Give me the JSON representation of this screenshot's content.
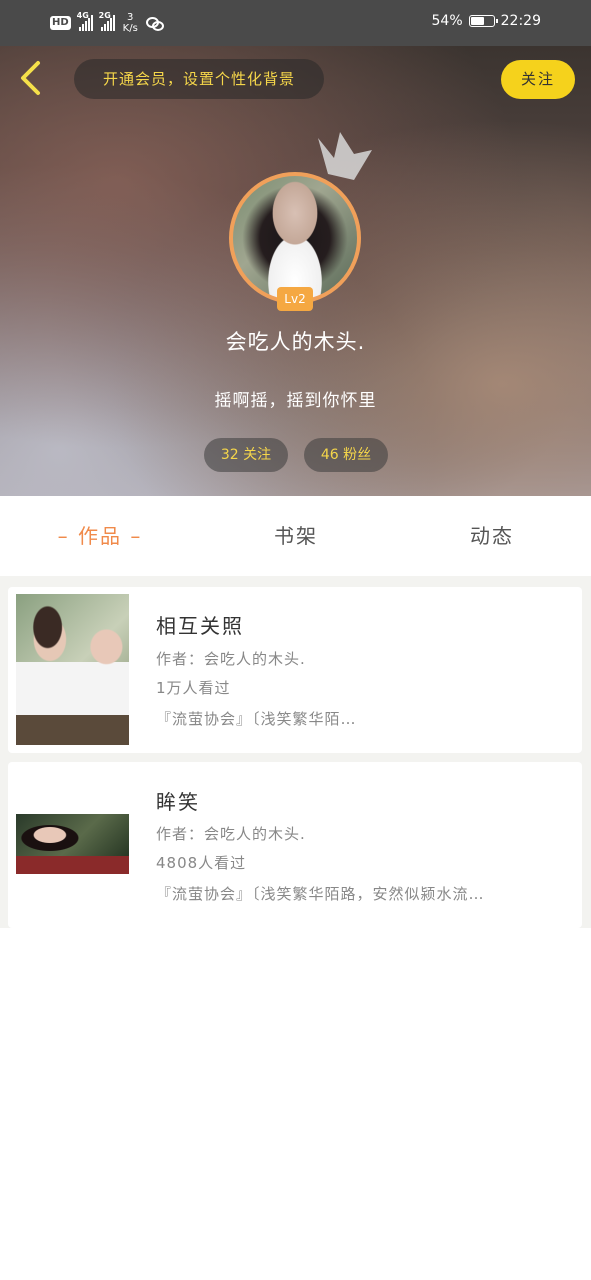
{
  "status_bar": {
    "hd_label": "HD",
    "sim1_label": "4G",
    "sim2_label": "2G",
    "net_speed_value": "3",
    "net_speed_unit": "K/s",
    "battery_percent": "54%",
    "battery_level": 0.54,
    "time": "22:29"
  },
  "header": {
    "vip_prompt": "开通会员，设置个性化背景",
    "follow_button": "关注",
    "level_badge": "Lv2",
    "nickname": "会吃人的木头.",
    "signature": "摇啊摇，摇到你怀里",
    "stats": {
      "following": "32 关注",
      "fans": "46 粉丝"
    }
  },
  "tabs": [
    {
      "label": "– 作品 –",
      "active": true
    },
    {
      "label": "书架",
      "active": false
    },
    {
      "label": "动态",
      "active": false
    }
  ],
  "works": [
    {
      "title": "相互关照",
      "author": "作者：会吃人的木头.",
      "views": "1万人看过",
      "excerpt": "『流萤协会』〔浅笑繁华陌…"
    },
    {
      "title": "眸笑",
      "author": "作者：会吃人的木头.",
      "views": "4808人看过",
      "excerpt": "『流萤协会』〔浅笑繁华陌路，安然似颍水流…"
    }
  ],
  "colors": {
    "accent_yellow": "#f5d21c",
    "accent_orange": "#f08a4a",
    "level_badge": "#f5a842"
  }
}
